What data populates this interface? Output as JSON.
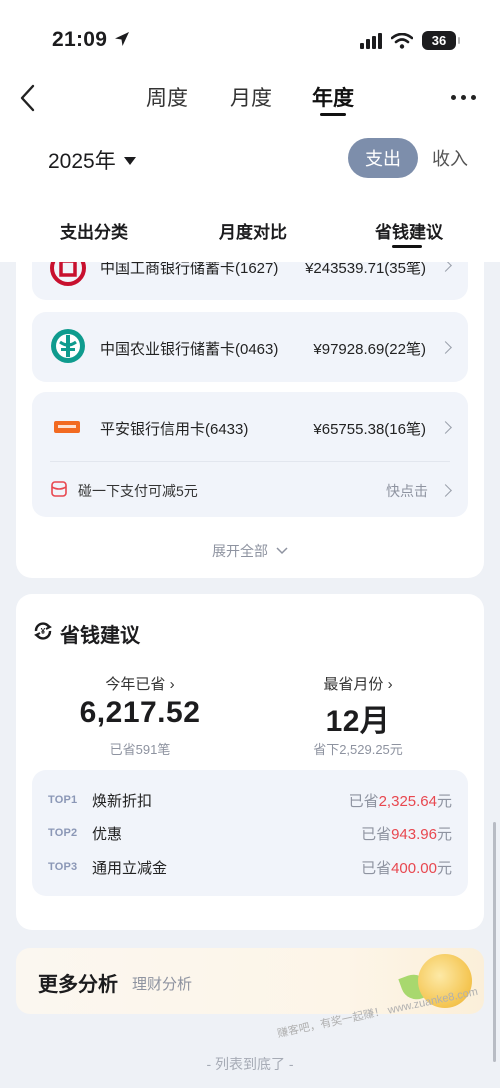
{
  "status_bar": {
    "time": "21:09",
    "battery": "36"
  },
  "nav": {
    "periods": [
      "周度",
      "月度",
      "年度"
    ],
    "active_period": "年度"
  },
  "filter": {
    "year": "2025年",
    "type_active": "支出",
    "type_other": "收入"
  },
  "sub_tabs": [
    "支出分类",
    "月度对比",
    "省钱建议"
  ],
  "payment_methods": [
    {
      "name": "中国工商银行储蓄卡(1627)",
      "amount": "¥243539.71(35笔)",
      "icon": "icbc-logo"
    },
    {
      "name": "中国农业银行储蓄卡(0463)",
      "amount": "¥97928.69(22笔)",
      "icon": "abc-logo"
    },
    {
      "name": "平安银行信用卡(6433)",
      "amount": "¥65755.38(16笔)",
      "icon": "pingan-logo"
    }
  ],
  "promo": {
    "text": "碰一下支付可减5元",
    "action": "快点击"
  },
  "expand_label": "展开全部",
  "savings": {
    "title": "省钱建议",
    "saved_label": "今年已省",
    "saved_value": "6,217.52",
    "saved_sub": "已省591笔",
    "best_month_label": "最省月份",
    "best_month_value": "12月",
    "best_month_sub": "省下2,529.25元",
    "top": [
      {
        "rank": "TOP1",
        "name": "焕新折扣",
        "prefix": "已省",
        "amount": "2,325.64",
        "unit": "元"
      },
      {
        "rank": "TOP2",
        "name": "优惠",
        "prefix": "已省",
        "amount": "943.96",
        "unit": "元"
      },
      {
        "rank": "TOP3",
        "name": "通用立减金",
        "prefix": "已省",
        "amount": "400.00",
        "unit": "元"
      }
    ]
  },
  "more_analysis": {
    "title": "更多分析",
    "sub": "理财分析"
  },
  "list_end": "- 列表到底了 -",
  "watermark": "赚客吧，有奖一起赚！ www.zuanke8.com",
  "colors": {
    "accent": "#7d8eab",
    "highlight_red": "#e8474f",
    "background": "#eef1f6"
  }
}
